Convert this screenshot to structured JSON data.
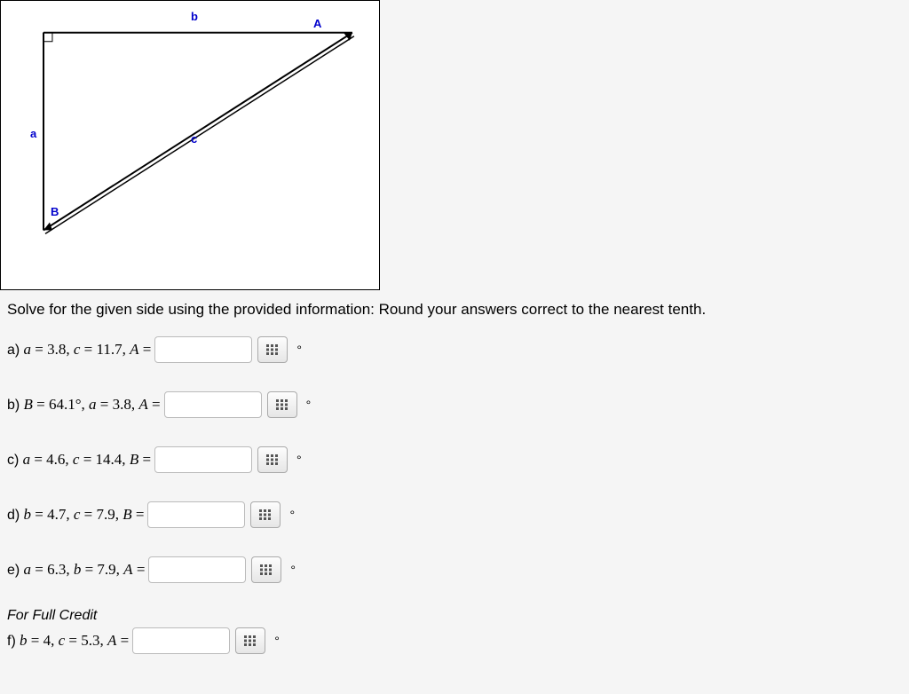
{
  "diagram": {
    "labels": {
      "a": "a",
      "b": "b",
      "c": "c",
      "A": "A",
      "B": "B"
    }
  },
  "instructions": "Solve for the given side using the provided information: Round your answers correct to the nearest tenth.",
  "questions": {
    "a": {
      "part": "a)",
      "text": "a = 3.8, c = 11.7, A ="
    },
    "b": {
      "part": "b)",
      "text": "B = 64.1°, a = 3.8, A ="
    },
    "c": {
      "part": "c)",
      "text": "a = 4.6, c = 14.4, B ="
    },
    "d": {
      "part": "d)",
      "text": "b = 4.7, c = 7.9, B ="
    },
    "e": {
      "part": "e)",
      "text": "a = 6.3, b = 7.9, A ="
    },
    "f": {
      "part": "f)",
      "text": "b = 4, c = 5.3, A ="
    }
  },
  "creditNote": "For Full Credit",
  "degreeSymbol": "°"
}
